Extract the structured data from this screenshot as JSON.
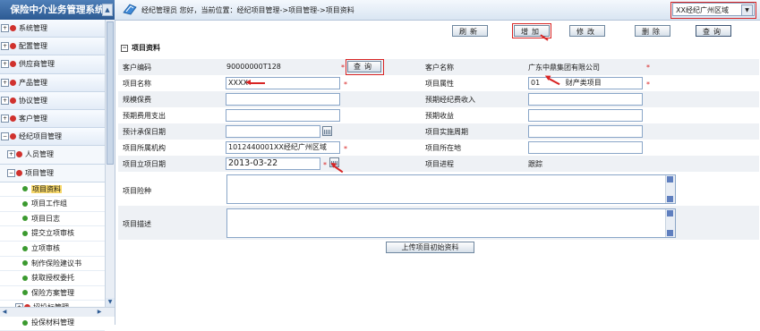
{
  "sidebar": {
    "title": "保险中介业务管理系统",
    "items": [
      {
        "label": "系统管理",
        "level": 1,
        "expand": "+"
      },
      {
        "label": "配置管理",
        "level": 1,
        "expand": "+"
      },
      {
        "label": "供应商管理",
        "level": 1,
        "expand": "+"
      },
      {
        "label": "产品管理",
        "level": 1,
        "expand": "+"
      },
      {
        "label": "协议管理",
        "level": 1,
        "expand": "+"
      },
      {
        "label": "客户管理",
        "level": 1,
        "expand": "+"
      },
      {
        "label": "经纪项目管理",
        "level": 1,
        "expand": "−"
      },
      {
        "label": "人员管理",
        "level": 2,
        "expand": "+"
      },
      {
        "label": "项目管理",
        "level": 2,
        "expand": "−"
      },
      {
        "label": "项目资料",
        "level": 3,
        "selected": true
      },
      {
        "label": "项目工作组",
        "level": 3
      },
      {
        "label": "项目日志",
        "level": 3
      },
      {
        "label": "提交立项审核",
        "level": 3
      },
      {
        "label": "立项审核",
        "level": 3
      },
      {
        "label": "制作保险建议书",
        "level": 3
      },
      {
        "label": "获取授权委托",
        "level": 3
      },
      {
        "label": "保险方案管理",
        "level": 3
      },
      {
        "label": "招投标管理",
        "level": 3,
        "expand": "+"
      },
      {
        "label": "投保材料管理",
        "level": 3
      }
    ]
  },
  "header": {
    "location": "经纪管理员 您好，当前位置：经纪项目管理->项目管理->项目资料",
    "region": "XX经纪广州区域"
  },
  "toolbar": {
    "refresh": "刷新",
    "add": "增加",
    "edit": "修改",
    "delete": "删除",
    "query": "查询"
  },
  "section_title": "项目资料",
  "form": {
    "customer_code_label": "客户编码",
    "customer_code": "90000000T128",
    "query_button": "查询",
    "customer_name_label": "客户名称",
    "customer_name": "广东中鼎集团有限公司",
    "project_name_label": "项目名称",
    "project_name": "XXXX",
    "project_attr_label": "项目属性",
    "project_attr_code": "01",
    "project_attr_name": "财产类项目",
    "scale_premium_label": "规模保费",
    "expected_income_label": "预期经纪费收入",
    "expected_cost_label": "预期费用支出",
    "expected_profit_label": "预期收益",
    "expected_date_label": "预计承保日期",
    "impl_period_label": "项目实施周期",
    "org_label": "项目所属机构",
    "org_value": "1012440001XX经纪广州区域",
    "location_label": "项目所在地",
    "setup_date_label": "项目立项日期",
    "setup_date": "2013-03-22",
    "progress_label": "项目进程",
    "progress_value": "跟踪",
    "risk_label": "项目险种",
    "desc_label": "项目描述",
    "upload_button": "上传项目初始资料"
  },
  "required_mark": "*"
}
